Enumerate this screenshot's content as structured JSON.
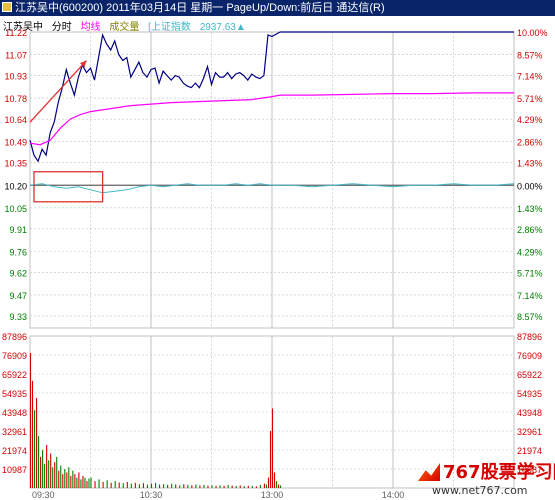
{
  "title_bar": "江苏吴中(600200)  2011年03月14日  星期一  PageUp/Down:前后日  通达信(R)",
  "legend": {
    "stock": "江苏吴中",
    "mode": "分时",
    "avg_label": "均线",
    "vol_label": "成交量",
    "index_label": "[上证指数",
    "index_value": "2937.63▲"
  },
  "colors": {
    "price_line": "#000080",
    "avg_line": "#ff00ff",
    "index_line": "#40b8c8",
    "up": "#d40000",
    "down": "#008000",
    "grid": "#c0c0c0",
    "neutral": "#000000",
    "annotation": "#e03030"
  },
  "watermark": {
    "logo_text": "767股票学习网",
    "url": "www.net767.com"
  },
  "chart_data": {
    "type": "line",
    "price_axis": {
      "ticks": [
        "11.22",
        "11.07",
        "10.93",
        "10.78",
        "10.64",
        "10.49",
        "10.35",
        "10.20",
        "10.05",
        "9.91",
        "9.76",
        "9.62",
        "9.47",
        "9.33"
      ],
      "pct_ticks": [
        "10.00%",
        "8.57%",
        "7.14%",
        "5.71%",
        "4.29%",
        "2.86%",
        "1.43%",
        "0.00%",
        "1.43%",
        "2.86%",
        "4.29%",
        "5.71%",
        "7.14%",
        "8.57%"
      ],
      "ylim": [
        9.25,
        11.22
      ],
      "prev_close": 10.2
    },
    "volume_axis": {
      "ticks": [
        "87896",
        "76909",
        "65922",
        "54935",
        "43948",
        "32961",
        "21974",
        "10987"
      ],
      "ylim": [
        0,
        87896
      ]
    },
    "time_axis": {
      "ticks": [
        "09:30",
        "10:30",
        "13:00",
        "14:00"
      ]
    },
    "minutes_total": 240,
    "series": [
      {
        "name": "价格",
        "x": [
          0,
          2,
          4,
          6,
          8,
          10,
          12,
          14,
          16,
          18,
          20,
          22,
          24,
          26,
          28,
          30,
          32,
          34,
          36,
          38,
          40,
          42,
          44,
          46,
          48,
          50,
          52,
          54,
          56,
          58,
          60,
          62,
          64,
          66,
          68,
          70,
          72,
          74,
          76,
          78,
          80,
          82,
          84,
          86,
          88,
          90,
          92,
          94,
          96,
          98,
          100,
          102,
          104,
          106,
          108,
          110,
          112,
          114,
          116,
          118,
          120,
          124
        ],
        "values": [
          10.5,
          10.4,
          10.36,
          10.44,
          10.4,
          10.55,
          10.62,
          10.75,
          10.85,
          10.97,
          10.88,
          10.8,
          10.92,
          11.0,
          10.95,
          10.98,
          10.9,
          11.05,
          11.2,
          11.14,
          11.1,
          11.16,
          11.07,
          11.03,
          11.05,
          10.92,
          10.97,
          11.02,
          10.95,
          10.92,
          10.97,
          10.98,
          10.88,
          10.96,
          10.93,
          10.9,
          10.93,
          10.92,
          10.88,
          10.86,
          10.85,
          10.88,
          10.85,
          10.91,
          10.99,
          10.87,
          10.95,
          10.92,
          10.92,
          10.95,
          10.91,
          10.94,
          10.95,
          10.93,
          10.9,
          10.94,
          10.92,
          10.91,
          10.93,
          11.2,
          11.19,
          11.22
        ]
      },
      {
        "name": "均价",
        "x": [
          0,
          5,
          10,
          15,
          20,
          25,
          30,
          40,
          50,
          60,
          70,
          80,
          90,
          100,
          110,
          115,
          120,
          124,
          140,
          160,
          180,
          200,
          220,
          240
        ],
        "values": [
          10.48,
          10.47,
          10.5,
          10.58,
          10.64,
          10.67,
          10.69,
          10.71,
          10.73,
          10.74,
          10.75,
          10.755,
          10.76,
          10.765,
          10.77,
          10.78,
          10.79,
          10.8,
          10.8,
          10.805,
          10.81,
          10.81,
          10.815,
          10.815
        ]
      },
      {
        "name": "上证指数",
        "x": [
          0,
          6,
          12,
          18,
          24,
          30,
          36,
          42,
          48,
          54,
          60,
          66,
          72,
          78,
          84,
          90,
          96,
          102,
          108,
          114,
          120,
          130,
          140,
          150,
          160,
          170,
          180,
          190,
          200,
          210,
          220,
          230,
          240
        ],
        "values": [
          10.2,
          10.21,
          10.19,
          10.18,
          10.19,
          10.17,
          10.15,
          10.16,
          10.17,
          10.19,
          10.2,
          10.19,
          10.2,
          10.21,
          10.2,
          10.2,
          10.2,
          10.21,
          10.2,
          10.21,
          10.2,
          10.2,
          10.19,
          10.2,
          10.21,
          10.2,
          10.19,
          10.2,
          10.2,
          10.21,
          10.2,
          10.2,
          10.21
        ]
      }
    ],
    "volume": {
      "x": [
        0,
        1,
        2,
        3,
        4,
        5,
        6,
        7,
        8,
        9,
        10,
        11,
        12,
        13,
        14,
        15,
        16,
        17,
        18,
        19,
        20,
        21,
        22,
        23,
        24,
        25,
        26,
        27,
        28,
        29,
        30,
        32,
        34,
        36,
        38,
        40,
        42,
        44,
        46,
        48,
        50,
        52,
        54,
        56,
        58,
        60,
        62,
        64,
        66,
        68,
        70,
        72,
        74,
        76,
        78,
        80,
        82,
        84,
        86,
        88,
        90,
        92,
        94,
        96,
        98,
        100,
        102,
        104,
        106,
        108,
        110,
        112,
        114,
        116,
        117,
        118,
        119,
        120,
        121,
        122,
        123,
        124
      ],
      "values": [
        78000,
        62000,
        45000,
        52000,
        30000,
        18000,
        22000,
        14000,
        25000,
        16000,
        20000,
        12000,
        15000,
        18000,
        10000,
        13000,
        8000,
        11000,
        9000,
        12000,
        7000,
        10000,
        8000,
        6000,
        9000,
        5000,
        7000,
        6000,
        4000,
        5500,
        6000,
        4000,
        5000,
        3500,
        4500,
        3000,
        4000,
        3200,
        2800,
        3500,
        2500,
        3000,
        2200,
        2800,
        2000,
        2500,
        3000,
        2000,
        2200,
        1800,
        2500,
        2000,
        1500,
        2200,
        1800,
        1600,
        2000,
        1500,
        1800,
        1400,
        1600,
        1300,
        1500,
        1200,
        1800,
        1400,
        1200,
        1500,
        1100,
        1300,
        1200,
        1000,
        1800,
        2500,
        2000,
        6000,
        33000,
        46000,
        9000,
        4000,
        2000,
        1500
      ],
      "colors": [
        "up",
        "up",
        "down",
        "up",
        "down",
        "up",
        "down",
        "down",
        "up",
        "down",
        "up",
        "down",
        "up",
        "down",
        "up",
        "down",
        "up",
        "down",
        "up",
        "down",
        "up",
        "down",
        "up",
        "down",
        "up",
        "down",
        "up",
        "down",
        "up",
        "down",
        "down",
        "up",
        "down",
        "up",
        "down",
        "up",
        "down",
        "up",
        "down",
        "up",
        "down",
        "up",
        "down",
        "up",
        "down",
        "up",
        "down",
        "up",
        "down",
        "up",
        "down",
        "up",
        "down",
        "up",
        "down",
        "up",
        "down",
        "up",
        "down",
        "up",
        "down",
        "up",
        "down",
        "up",
        "down",
        "up",
        "down",
        "up",
        "down",
        "up",
        "down",
        "up",
        "down",
        "up",
        "down",
        "up",
        "up",
        "up",
        "up",
        "down",
        "up",
        "down"
      ]
    },
    "annotations": [
      {
        "type": "arrow",
        "from": {
          "minute": 0,
          "price": 10.62
        },
        "to": {
          "minute": 28,
          "price": 11.03
        }
      },
      {
        "type": "rect",
        "minute_range": [
          0,
          36
        ],
        "price_range": [
          10.09,
          10.29
        ]
      }
    ]
  }
}
